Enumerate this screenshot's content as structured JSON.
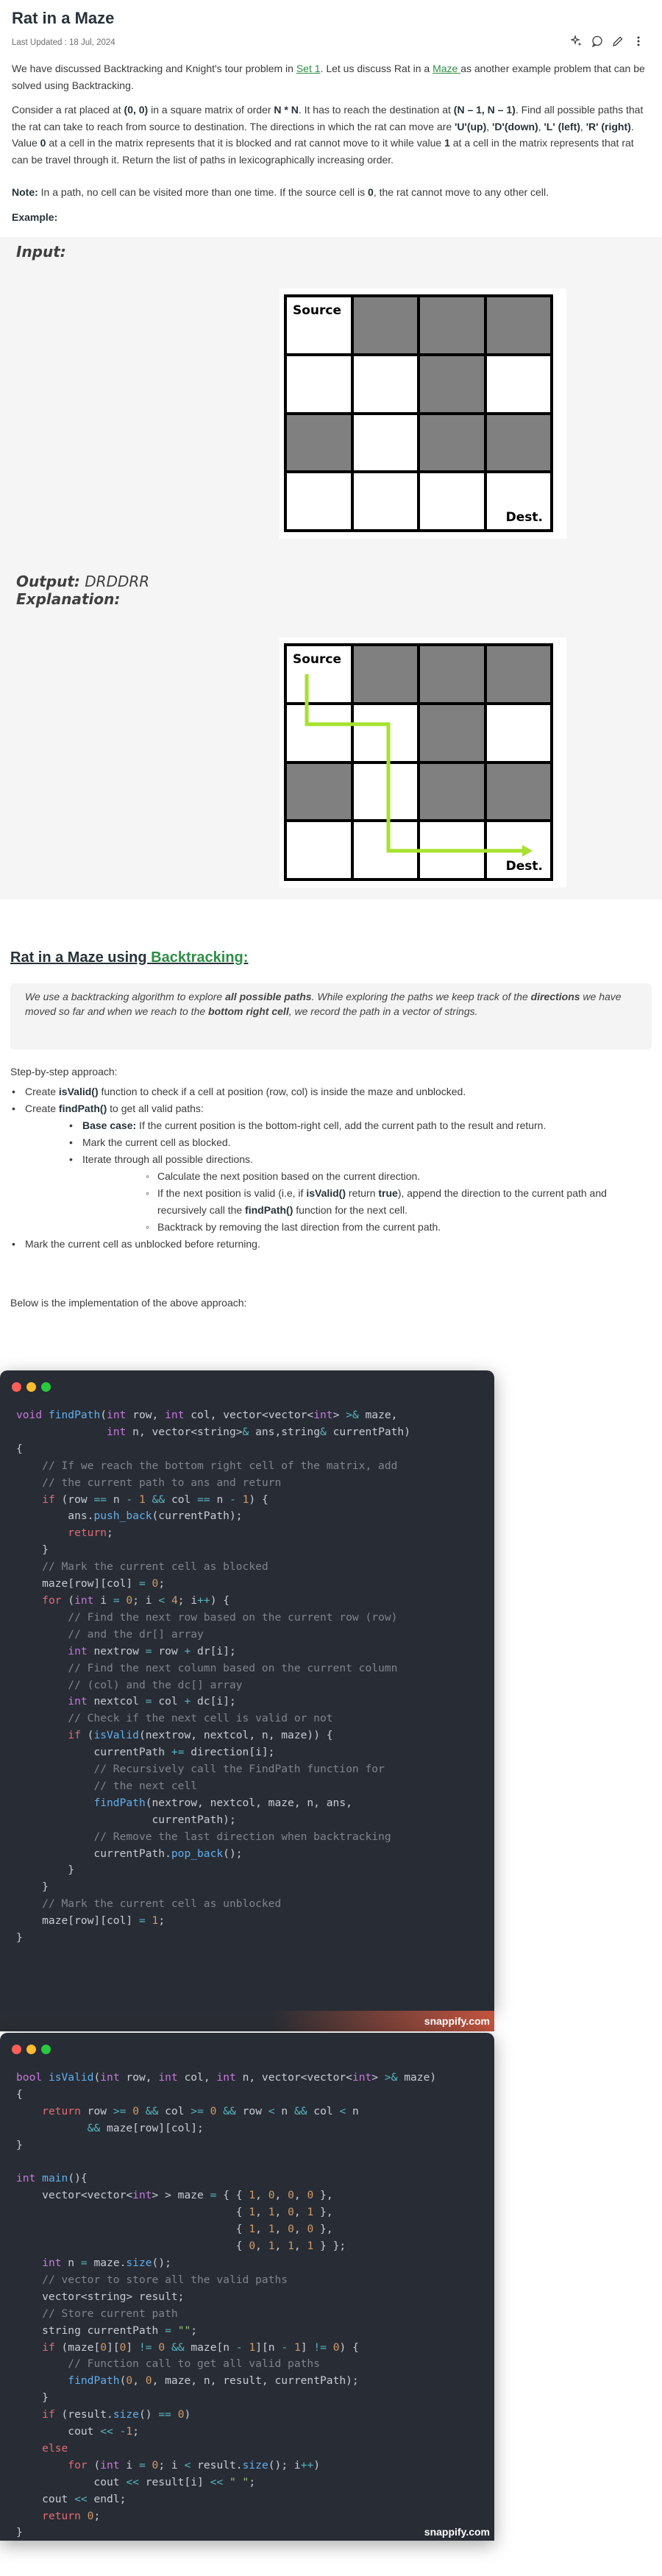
{
  "article": {
    "title": "Rat in a Maze",
    "last_updated": "Last Updated : 18 Jul, 2024"
  },
  "toolbar": {
    "icons": [
      "ai-sparkle-icon",
      "comment-icon",
      "edit-icon",
      "more-icon"
    ]
  },
  "intro": {
    "p1_a": "We have discussed Backtracking and Knight's tour problem in ",
    "p1_link1": "Set 1",
    "p1_b": ". Let us discuss Rat in a ",
    "p1_link2": "Maze ",
    "p1_c": "as another example problem that can be solved using Backtracking.",
    "p2_a": "Consider a rat placed at ",
    "p2_b1": "(0, 0)",
    "p2_c": " in a square matrix of order ",
    "p2_b2": "N * N",
    "p2_d": ". It has to reach the destination at ",
    "p2_b3": "(N – 1, N – 1)",
    "p2_e": ". Find all possible paths that the rat can take to reach from source to destination. The directions in which the rat can move are ",
    "p2_b4": "'U'(up)",
    "p2_f": ", ",
    "p2_b5": "'D'(down)",
    "p2_g": ", ",
    "p2_b6": "'L' (left)",
    "p2_h": ", ",
    "p2_b7": "'R' (right)",
    "p2_i": ". Value ",
    "p2_b8": "0",
    "p2_j": " at a cell in the matrix represents that it is blocked and rat cannot move to it while value ",
    "p2_b9": "1",
    "p2_k": " at a cell in the matrix represents that rat can be travel through it. Return the list of paths in lexicographically increasing order.",
    "note_label": "Note:",
    "note_text": " In a path, no cell can be visited more than one time. If the source cell is ",
    "note_b": "0",
    "note_end": ", the rat cannot move to any other cell.",
    "example_label": "Example:"
  },
  "example": {
    "input_label": "Input:",
    "output_label": "Output:",
    "output_value": " DRDDRR",
    "explanation_label": "Explanation:",
    "source_label": "Source",
    "dest_label": "Dest.",
    "maze": [
      [
        1,
        0,
        0,
        0
      ],
      [
        1,
        1,
        0,
        1
      ],
      [
        0,
        1,
        0,
        0
      ],
      [
        1,
        1,
        1,
        1
      ]
    ],
    "path_color": "#a6e22e"
  },
  "section": {
    "title_a": "Rat in a Maze using ",
    "title_link": "Backtracking:",
    "quote_a": "We use a backtracking algorithm to explore ",
    "quote_b1": "all possible paths",
    "quote_c": ". While exploring the paths we keep track of the ",
    "quote_b2": "directions",
    "quote_d": " we have moved so far and when we reach to the ",
    "quote_b3": "bottom right cell",
    "quote_e": ", we record the path in a vector of strings.",
    "approach_label": "Step-by-step approach:",
    "impl_label": "Below is the implementation of the above approach:"
  },
  "steps": {
    "s1_a": "Create ",
    "s1_b": "isValid()",
    "s1_c": " function to check if a cell at position (row, col) is inside the maze and unblocked.",
    "s2_a": "Create ",
    "s2_b": "findPath()",
    "s2_c": " to get all valid paths:",
    "s3_a": "Base case:",
    "s3_b": " If the current position is the bottom-right cell, add the current path to the result and return.",
    "s4": "Mark the current cell as blocked.",
    "s5": "Iterate through all possible directions.",
    "s6": "Calculate the next position based on the current direction.",
    "s7_a": "If the next position is valid (i.e, if ",
    "s7_b": "isValid()",
    "s7_c": " return ",
    "s7_d": "true",
    "s7_e": "), append the direction to the current path and recursively call the ",
    "s7_f": "findPath()",
    "s7_g": " function for the next cell.",
    "s8": "Backtrack by removing the last direction from the current path.",
    "s9": "Mark the current cell as unblocked before returning."
  },
  "code": {
    "watermark": "snappify.com"
  }
}
